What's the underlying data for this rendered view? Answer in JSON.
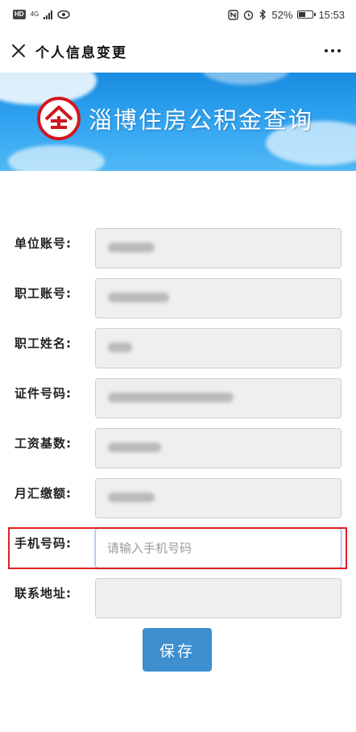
{
  "status_bar": {
    "left_badge": "HD",
    "network": "4G",
    "battery_percent": "52%",
    "battery_level": 0.52,
    "time": "15:53"
  },
  "nav": {
    "title": "个人信息变更"
  },
  "banner": {
    "title": "淄博住房公积金查询"
  },
  "form": {
    "fields": [
      {
        "label": "单位账号:"
      },
      {
        "label": "职工账号:"
      },
      {
        "label": "职工姓名:"
      },
      {
        "label": "证件号码:"
      },
      {
        "label": "工资基数:"
      },
      {
        "label": "月汇缴额:"
      },
      {
        "label": "手机号码:",
        "placeholder": "请输入手机号码"
      },
      {
        "label": "联系地址:"
      }
    ],
    "save_label": "保存"
  },
  "colors": {
    "accent": "#3d8fd0",
    "banner": "#2ea2f0",
    "highlight": "#e02020",
    "logo": "#d2161e"
  }
}
